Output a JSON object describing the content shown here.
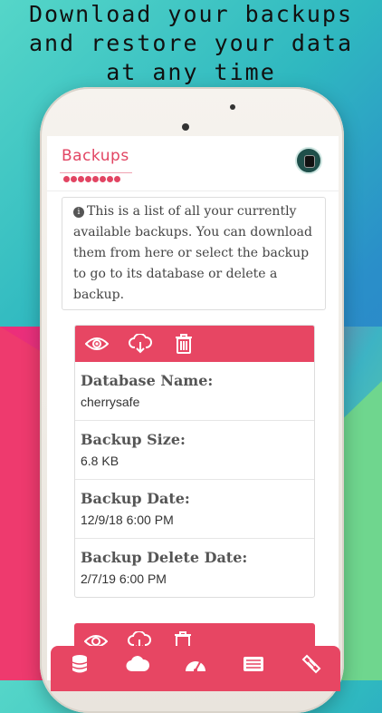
{
  "headline": {
    "line1": "Download your backups",
    "line2": "and restore your data",
    "line3": "at any time"
  },
  "app": {
    "logo_text": "Backups",
    "info_text": "This is a list of all your currently available backups. You can download them from here or select the backup to go to its database or delete a backup."
  },
  "backups": [
    {
      "actions": [
        "eye-icon",
        "cloud-download-icon",
        "trash-icon"
      ],
      "fields": [
        {
          "label": "Database Name:",
          "value": "cherrysafe"
        },
        {
          "label": "Backup Size:",
          "value": "6.8 KB"
        },
        {
          "label": "Backup Date:",
          "value": "12/9/18 6:00 PM"
        },
        {
          "label": "Backup Delete Date:",
          "value": "2/7/19 6:00 PM"
        }
      ]
    }
  ],
  "tabbar": {
    "items": [
      "database-icon",
      "cloud-icon",
      "dashboard-icon",
      "list-icon",
      "ticket-icon"
    ]
  },
  "colors": {
    "accent": "#e74663",
    "text": "#444444"
  }
}
